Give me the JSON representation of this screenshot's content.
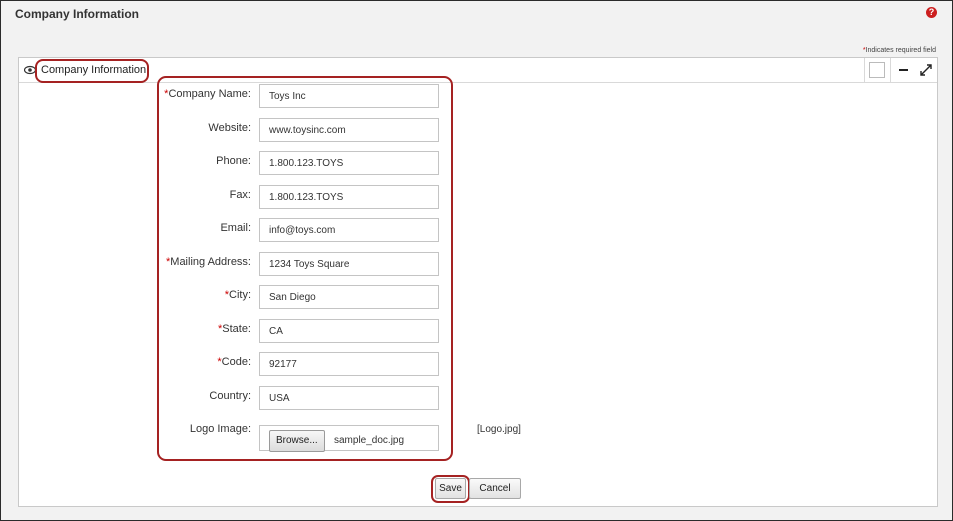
{
  "page": {
    "title": "Company Information",
    "required_note_star": "*",
    "required_note": "Indicates required field"
  },
  "panel": {
    "title": "Company Information"
  },
  "form": {
    "fields": [
      {
        "label": "Company Name:",
        "required": true,
        "value": "Toys Inc"
      },
      {
        "label": "Website:",
        "required": false,
        "value": "www.toysinc.com"
      },
      {
        "label": "Phone:",
        "required": false,
        "value": "1.800.123.TOYS"
      },
      {
        "label": "Fax:",
        "required": false,
        "value": "1.800.123.TOYS"
      },
      {
        "label": "Email:",
        "required": false,
        "value": "info@toys.com"
      },
      {
        "label": "Mailing Address:",
        "required": true,
        "value": "1234 Toys Square"
      },
      {
        "label": "City:",
        "required": true,
        "value": "San Diego"
      },
      {
        "label": "State:",
        "required": true,
        "value": "CA"
      },
      {
        "label": "Code:",
        "required": true,
        "value": "92177"
      },
      {
        "label": "Country:",
        "required": false,
        "value": "USA"
      }
    ],
    "logo": {
      "label": "Logo Image:",
      "browse_label": "Browse...",
      "file_name": "sample_doc.jpg",
      "current_ref": "[Logo.jpg]"
    }
  },
  "actions": {
    "save_label": "Save",
    "cancel_label": "Cancel"
  },
  "icons": {
    "help": "help-icon",
    "eye": "eye-icon",
    "minimize": "minimize-icon",
    "maximize": "maximize-icon"
  },
  "colors": {
    "highlight": "#a52222",
    "required_star": "#cc0000",
    "help_icon": "#cc1f1f"
  }
}
